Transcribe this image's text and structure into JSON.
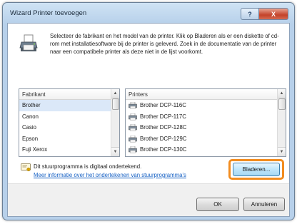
{
  "window": {
    "title": "Wizard Printer toevoegen",
    "help_label": "?",
    "close_label": "X"
  },
  "intro": {
    "text": "Selecteer de fabrikant en het model van de printer. Klik op Bladeren als er een diskette of cd-rom met installatiesoftware bij de printer is geleverd. Zoek in de documentatie van de printer naar een compatibele printer als deze niet in de lijst voorkomt."
  },
  "manufacturers": {
    "header": "Fabrikant",
    "items": [
      "Brother",
      "Canon",
      "Casio",
      "Epson",
      "Fuji Xerox"
    ],
    "selected": "Brother"
  },
  "printers": {
    "header": "Printers",
    "items": [
      "Brother DCP-116C",
      "Brother DCP-117C",
      "Brother DCP-128C",
      "Brother DCP-129C",
      "Brother DCP-130C"
    ]
  },
  "signature": {
    "status": "Dit stuurprogramma is digitaal ondertekend.",
    "link": "Meer informatie over het ondertekenen van stuurprogramma's"
  },
  "buttons": {
    "browse": "Bladeren...",
    "ok": "OK",
    "cancel": "Annuleren"
  },
  "colors": {
    "highlight": "#f28c1f",
    "link": "#1560c4",
    "close": "#c4432a"
  },
  "icons": {
    "wizard": "printer-icon",
    "signature": "certificate-icon",
    "printer_row": "printer-icon"
  }
}
